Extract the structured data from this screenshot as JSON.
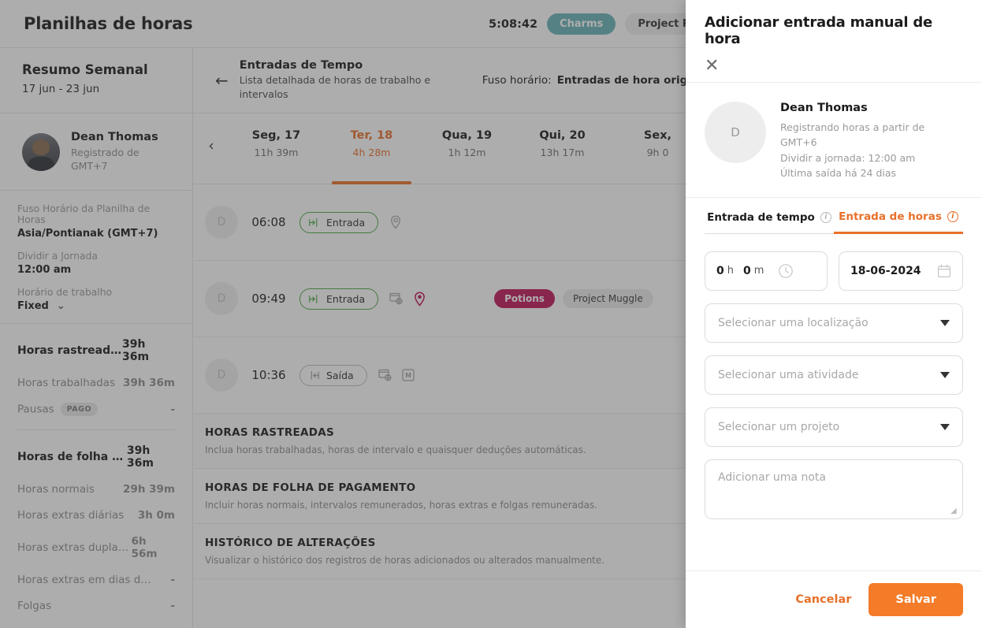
{
  "topbar": {
    "title": "Planilhas de horas",
    "timer": "5:08:42",
    "chip_teal": "Charms",
    "chip_grey": "Project Philosop"
  },
  "subheader": {
    "summary_title": "Resumo Semanal",
    "summary_range": "17 jun - 23 jun",
    "back_icon": "←",
    "entries_title": "Entradas de Tempo",
    "entries_sub": "Lista detalhada de horas de trabalho e intervalos",
    "tz_label": "Fuso horário:",
    "tz_value": "Entradas de hora originais"
  },
  "sidebar": {
    "user": {
      "name": "Dean Thomas",
      "sub_line1": "Registrado de",
      "sub_line2": "GMT+7"
    },
    "meta": [
      {
        "label": "Fuso Horário da Planilha de Horas",
        "value": "Asia/Pontianak (GMT+7)"
      },
      {
        "label": "Dividir a Jornada",
        "value": "12:00 am"
      },
      {
        "label": "Horário de trabalho",
        "value": "Fixed"
      }
    ],
    "stats_group1": [
      {
        "label": "Horas rastreadas",
        "value": "39h 36m",
        "bold": true
      },
      {
        "label": "Horas trabalhadas",
        "value": "39h 36m",
        "bold": false
      },
      {
        "label": "Pausas",
        "badge": "PAGO",
        "value": "-",
        "bold": false
      }
    ],
    "stats_group2": [
      {
        "label": "Horas de folha de...",
        "value": "39h 36m",
        "bold": true
      },
      {
        "label": "Horas normais",
        "value": "29h 39m",
        "bold": false
      },
      {
        "label": "Horas extras diárias",
        "value": "3h 0m",
        "bold": false
      },
      {
        "label": "Horas extras duplas...",
        "value": "6h 56m",
        "bold": false
      },
      {
        "label": "Horas extras em dias de de...",
        "value": "-",
        "bold": false
      },
      {
        "label": "Folgas",
        "value": "-",
        "bold": false
      }
    ]
  },
  "main": {
    "days": [
      {
        "name": "Seg, 17",
        "duration": "11h 39m",
        "active": false
      },
      {
        "name": "Ter, 18",
        "duration": "4h 28m",
        "active": true
      },
      {
        "name": "Qua, 19",
        "duration": "1h 12m",
        "active": false
      },
      {
        "name": "Qui, 20",
        "duration": "13h 17m",
        "active": false
      },
      {
        "name": "Sex,",
        "duration": "9h 0",
        "active": false
      }
    ],
    "prev_icon": "‹",
    "entries": [
      {
        "avatar": "D",
        "time": "06:08",
        "type": "Entrada",
        "direction": "in",
        "icons": [
          "location-pin-outline-icon"
        ],
        "tags": []
      },
      {
        "avatar": "D",
        "time": "09:49",
        "type": "Entrada",
        "direction": "in",
        "icons": [
          "browser-icon",
          "location-pin-filled-icon"
        ],
        "tags": [
          {
            "text": "Potions",
            "style": "red"
          },
          {
            "text": "Project Muggle",
            "style": "grey"
          }
        ]
      },
      {
        "avatar": "D",
        "time": "10:36",
        "type": "Saída",
        "direction": "out",
        "icons": [
          "browser-icon",
          "manual-m-icon"
        ],
        "tags": []
      }
    ],
    "sections": [
      {
        "title": "HORAS RASTREADAS",
        "sub": "Inclua horas trabalhadas, horas de intervalo e quaisquer deduções automáticas."
      },
      {
        "title": "HORAS DE FOLHA DE PAGAMENTO",
        "sub": "Incluir horas normais, intervalos remunerados, horas extras e folgas remuneradas."
      },
      {
        "title": "HISTÓRICO DE ALTERAÇÕES",
        "sub": "Visualizar o histórico dos registros de horas adicionados ou alterados manualmente."
      }
    ]
  },
  "panel": {
    "title": "Adicionar entrada manual de hora",
    "close_icon": "✕",
    "user": {
      "avatar_letter": "D",
      "name": "Dean Thomas",
      "line1": "Registrando horas a partir de GMT+6",
      "line2": "Dividir a jornada: 12:00 am",
      "line3": "Última saída há 24 dias"
    },
    "tabs": [
      {
        "label": "Entrada de tempo",
        "active": false
      },
      {
        "label": "Entrada de horas",
        "active": true
      }
    ],
    "duration": {
      "hours": "0",
      "hours_unit": "h",
      "minutes": "0",
      "minutes_unit": "m"
    },
    "date_value": "18-06-2024",
    "selects": [
      {
        "placeholder": "Selecionar uma localização"
      },
      {
        "placeholder": "Selecionar uma atividade"
      },
      {
        "placeholder": "Selecionar um projeto"
      }
    ],
    "note_placeholder": "Adicionar uma nota",
    "cancel_label": "Cancelar",
    "save_label": "Salvar"
  },
  "colors": {
    "accent_orange": "#e8702a",
    "save_orange": "#f47b28",
    "teal": "#69b4b8",
    "crimson": "#c2185b",
    "green": "#49a942"
  }
}
